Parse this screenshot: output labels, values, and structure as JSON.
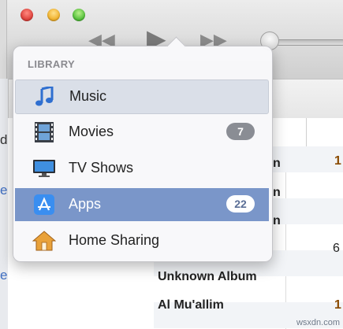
{
  "window": {
    "controls": [
      "close",
      "minimize",
      "zoom"
    ],
    "transport": {
      "prev_icon": "previous-icon",
      "play_icon": "play-icon",
      "next_icon": "next-icon"
    }
  },
  "background_fragments": {
    "left": [
      "di",
      "e",
      "e"
    ],
    "rows": [
      {
        "album": "n",
        "num": "1"
      },
      {
        "album": "n",
        "num": ""
      },
      {
        "album": "n",
        "num": ""
      },
      {
        "album": "",
        "num": "6"
      },
      {
        "album": "Unknown Album",
        "num": ""
      },
      {
        "album": "Al Mu'allim",
        "num": "1"
      }
    ]
  },
  "library_popover": {
    "header": "LIBRARY",
    "items": [
      {
        "label": "Music",
        "icon": "music-note-icon",
        "badge": "",
        "state": "selected"
      },
      {
        "label": "Movies",
        "icon": "film-strip-icon",
        "badge": "7",
        "state": "normal"
      },
      {
        "label": "TV Shows",
        "icon": "tv-monitor-icon",
        "badge": "",
        "state": "normal"
      },
      {
        "label": "Apps",
        "icon": "app-store-icon",
        "badge": "22",
        "state": "highlighted"
      },
      {
        "label": "Home Sharing",
        "icon": "home-icon",
        "badge": "",
        "state": "normal"
      }
    ]
  },
  "watermark": "wsxdn.com",
  "colors": {
    "highlight": "#7a96c9",
    "selected": "#dadfe8",
    "badge_gray": "#8a8d94"
  }
}
